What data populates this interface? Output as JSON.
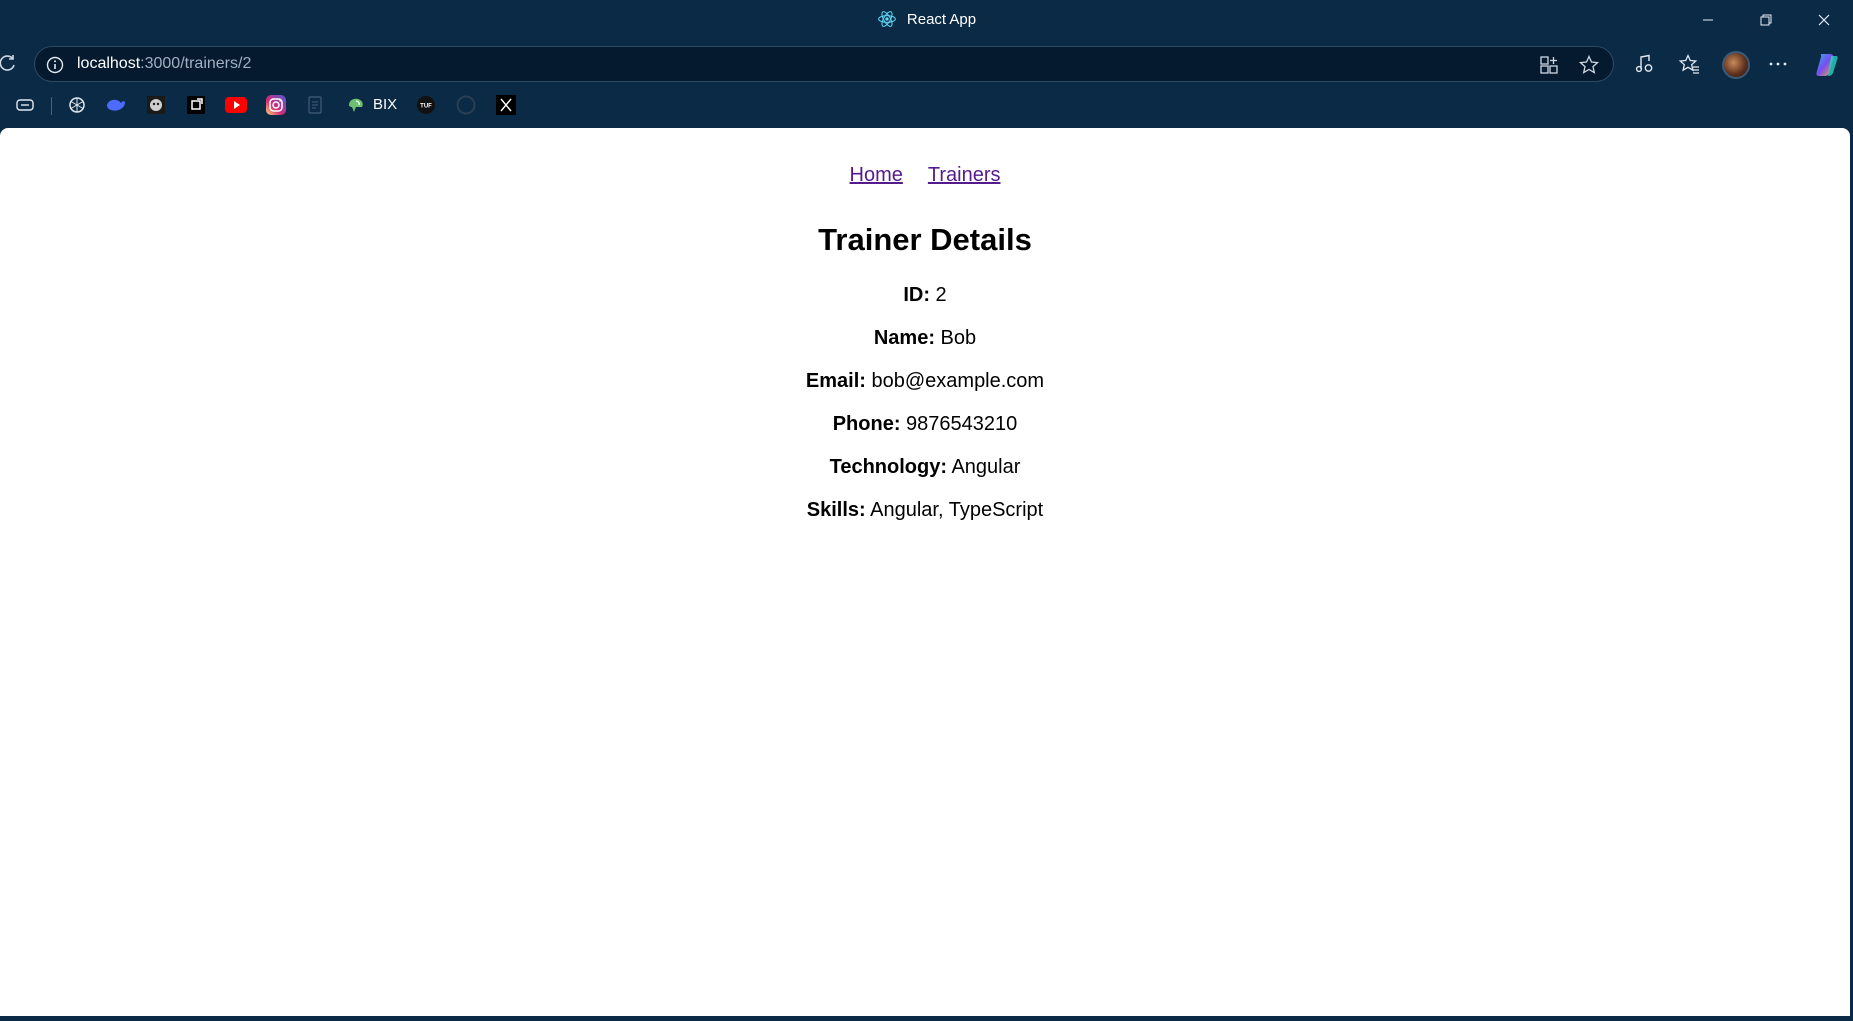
{
  "window": {
    "title": "React App",
    "controls": [
      "minimize-icon",
      "restore-icon",
      "close-icon"
    ]
  },
  "toolbar": {
    "url_host": "localhost",
    "url_path": ":3000/trainers/2",
    "icons": [
      "reload-icon",
      "site-info-icon",
      "app-available-icon",
      "favorite-star-icon",
      "music-icon",
      "favorites-icon",
      "profile-avatar",
      "more-options-icon",
      "copilot-icon"
    ]
  },
  "bookmarks": {
    "items": [
      "bookmark-collections-icon",
      "chatgpt-icon",
      "deepseek-icon",
      "anime-icon",
      "bookmark-app-icon",
      "youtube-icon",
      "instagram-icon",
      "docs-icon",
      "bix-logo-icon",
      "tuf-icon",
      "github-icon",
      "x-icon"
    ],
    "bix_label": "BIX"
  },
  "nav": {
    "home": "Home",
    "trainers": "Trainers"
  },
  "heading": "Trainer Details",
  "details": {
    "id_label": "ID:",
    "id_value": "2",
    "name_label": "Name:",
    "name_value": "Bob",
    "email_label": "Email:",
    "email_value": "bob@example.com",
    "phone_label": "Phone:",
    "phone_value": "9876543210",
    "technology_label": "Technology:",
    "technology_value": "Angular",
    "skills_label": "Skills:",
    "skills_value": "Angular, TypeScript"
  },
  "colors": {
    "chrome_bg": "#0b2a45",
    "link": "#551a8b",
    "page_bg": "#ffffff"
  }
}
